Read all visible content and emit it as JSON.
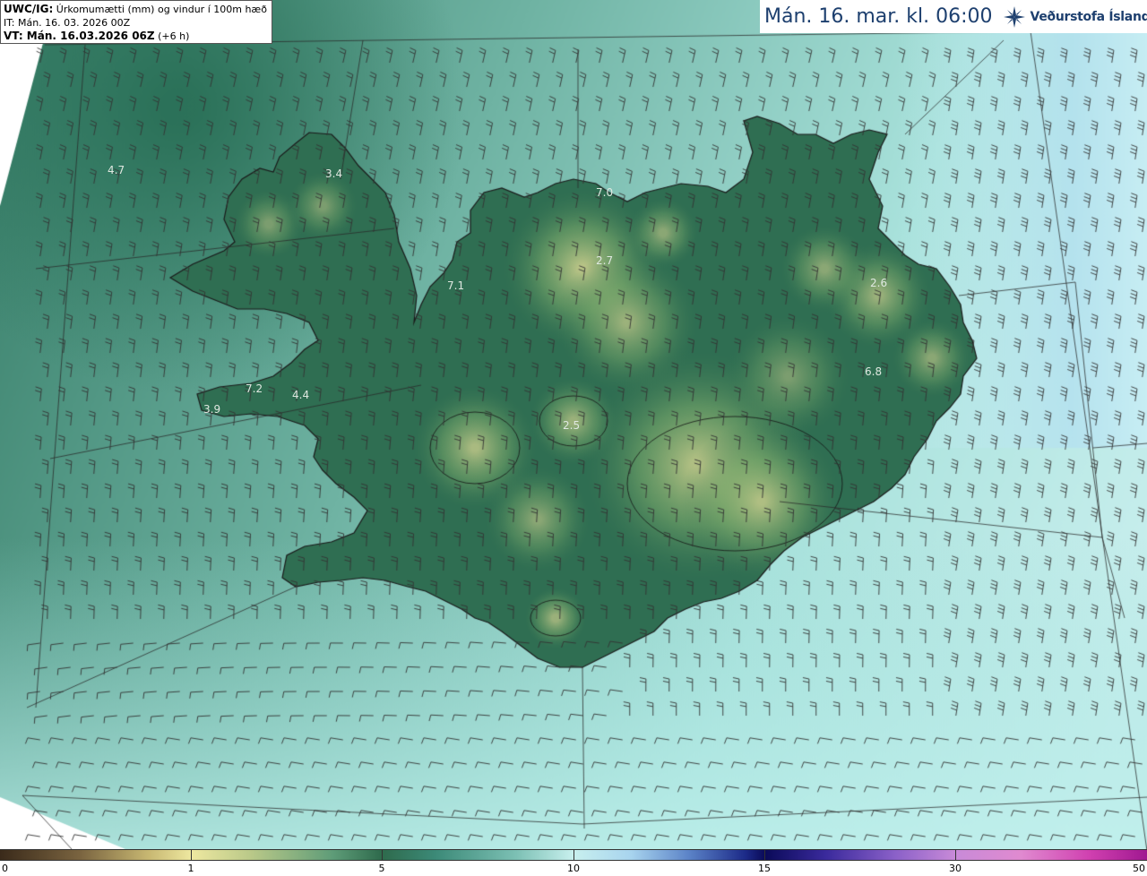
{
  "info_box": {
    "line1_bold": "UWC/IG:",
    "line1_rest": " Úrkomumætti (mm) og vindur í 100m hæð",
    "line2": "IT: Mán. 16. 03. 2026 00Z",
    "line3_bold": "VT: Mán. 16.03.2026 06Z",
    "line3_rest": " (+6 h)"
  },
  "header": {
    "time_label": "Mán. 16. mar. kl. 06:00",
    "logo_text": "Veðurstofa Íslands",
    "logo_icon": "snowflake-icon"
  },
  "colorbar": {
    "labels": [
      "0",
      "1",
      "5",
      "10",
      "15",
      "30",
      "50"
    ]
  },
  "map_values": [
    "4.7",
    "3.4",
    "7.0",
    "2.7",
    "7.1",
    "2.6",
    "7.2",
    "4.4",
    "3.9",
    "2.5",
    "6.8"
  ],
  "colors": {
    "land_low": "#2f6e52",
    "land_high": "#c2c98a",
    "sea_west": "#5f9e88",
    "sea_east": "#c9efee",
    "coast": "#1a1a1a",
    "barb": "#333333",
    "brand": "#1d3f6e"
  }
}
